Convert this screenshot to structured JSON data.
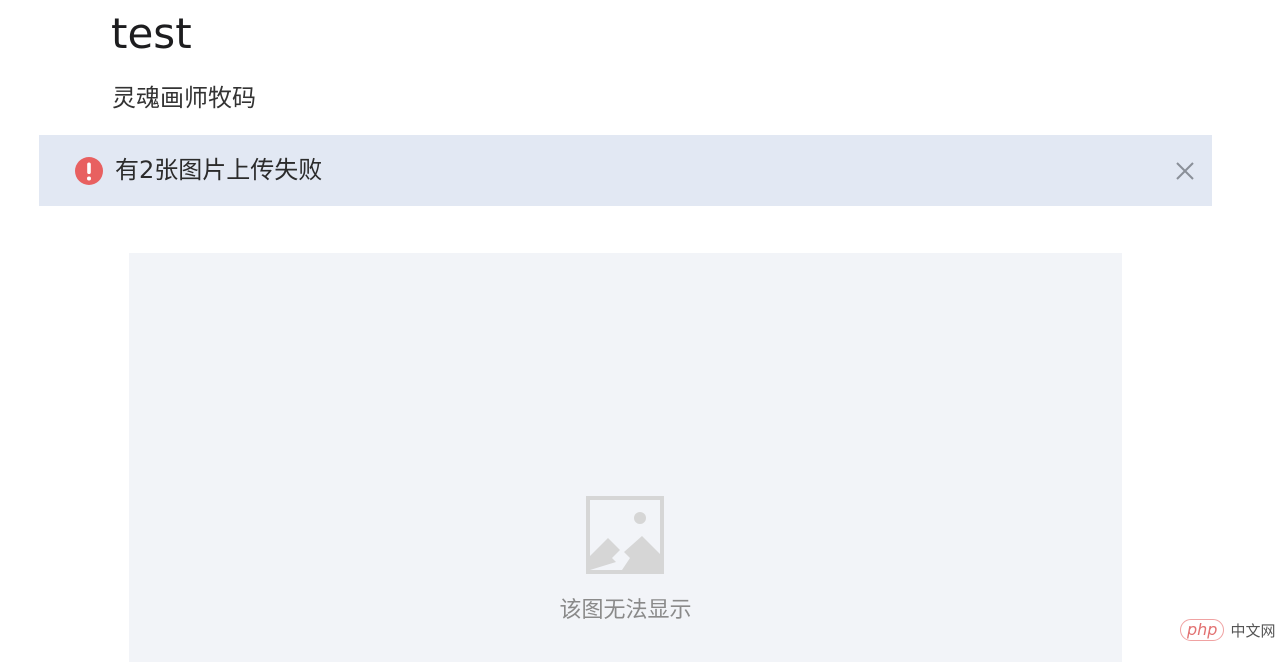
{
  "article": {
    "title": "test",
    "author": "灵魂画师牧码"
  },
  "alert": {
    "message": "有2张图片上传失败",
    "icon": "error-exclamation-icon",
    "close_icon": "close-icon",
    "accent_color": "#e86060",
    "background": "#e2e8f3"
  },
  "image_placeholder": {
    "icon": "broken-image-icon",
    "message": "该图无法显示"
  },
  "watermark": {
    "logo_text": "php",
    "site_text": "中文网"
  }
}
